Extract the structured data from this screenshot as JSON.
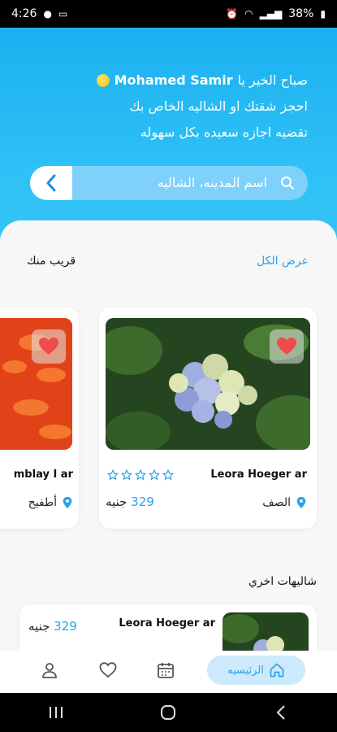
{
  "status": {
    "time": "4:26",
    "battery": "38%"
  },
  "hero": {
    "greeting_prefix": "صباح الخير يا",
    "user_name": "Mohamed Samir",
    "line2": "احجز شقتك او الشاليه الخاص بك",
    "line3": "تقضيه اجازه سعيده بكل سهوله"
  },
  "search": {
    "placeholder": "اسم المدينه، الشاليه"
  },
  "nearby": {
    "title": "قريب منك",
    "view_all": "عرض الكل",
    "cards": [
      {
        "title": "Leora Hoeger ar",
        "location": "الصف",
        "price_value": "329",
        "price_unit": "جنيه",
        "rating": 0,
        "max_rating": 5
      },
      {
        "title": "mblay I ar",
        "location": "أطفيح"
      }
    ]
  },
  "others": {
    "title": "شاليهات اخري",
    "cards": [
      {
        "title": "Leora Hoeger ar",
        "price_value": "329",
        "price_unit": "جنيه"
      }
    ]
  },
  "nav": {
    "home_label": "الرئيسيه"
  },
  "colors": {
    "primary": "#2aa2ea",
    "hero": "#1bb0f0",
    "favorite": "#ef4b4b"
  }
}
